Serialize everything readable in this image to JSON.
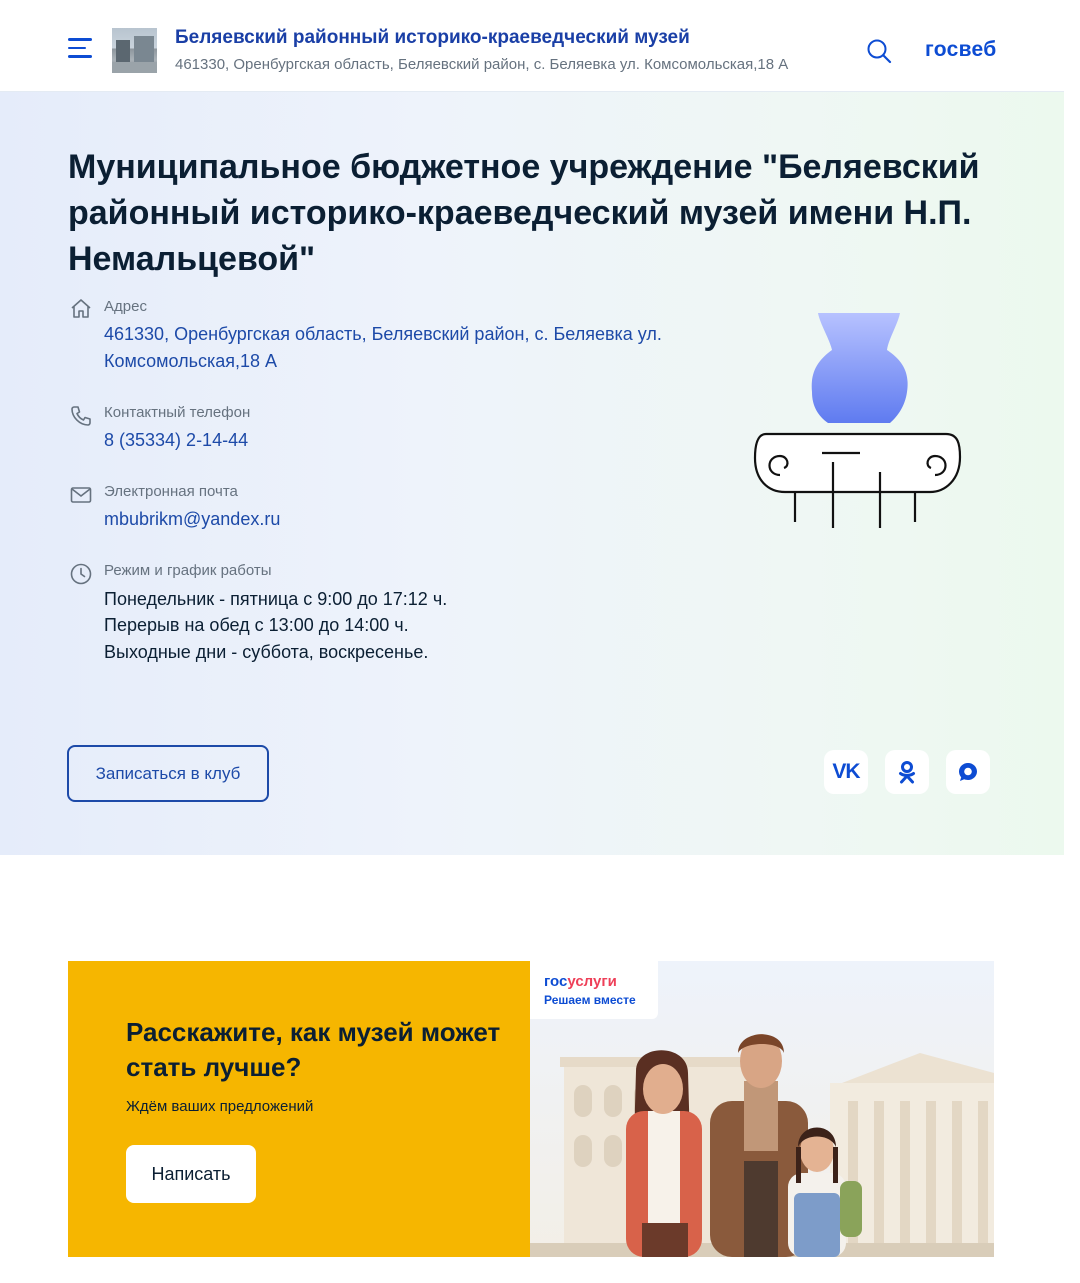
{
  "header": {
    "museum_title": "Беляевский районный историко-краеведческий музей",
    "museum_address": "461330, Оренбургская область, Беляевский район, с. Беляевка ул. Комсомольская,18 А",
    "logo_text": "госвеб"
  },
  "hero": {
    "title": "Муниципальное бюджетное учреждение \"Беляевский районный историко-краеведческий музей имени Н.П. Немальцевой\"",
    "address_label": "Адрес",
    "address_line1": "461330, Оренбургская область, Беляевский район, с. Беляевка ул.",
    "address_line2": "Комсомольская,18 А",
    "phone_label": "Контактный телефон",
    "phone": "8 (35334) 2-14-44",
    "email_label": "Электронная почта",
    "email": "mbubrikm@yandex.ru",
    "hours_label": "Режим и график работы",
    "hours_line1": "Понедельник - пятница с 9:00 до 17:12 ч.",
    "hours_line2": "Перерыв на обед с 13:00 до 14:00 ч.",
    "hours_line3": "Выходные дни - суббота, воскресенье.",
    "club_button": "Записаться в клуб",
    "social": {
      "vk": "VK",
      "ok": "ОК"
    }
  },
  "banner": {
    "title": "Расскажите, как музей может стать лучше?",
    "subtitle": "Ждём ваших предложений",
    "button": "Написать",
    "gu_logo_a": "гос",
    "gu_logo_b": "услуги",
    "gu_tagline": "Решаем вместе"
  },
  "colors": {
    "accent": "#0d4cd3",
    "banner_yellow": "#f6b600",
    "text": "#0b1f33",
    "muted": "#66727f"
  }
}
